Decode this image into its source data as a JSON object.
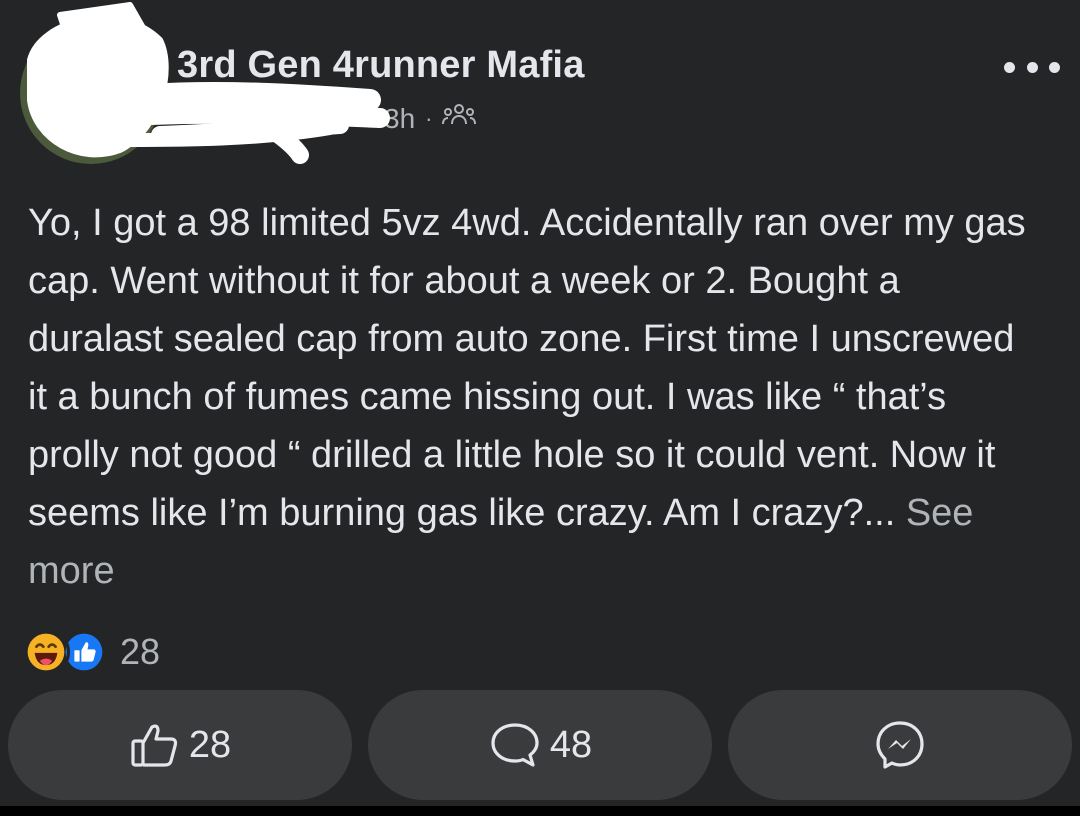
{
  "post": {
    "group_name": "3rd Gen 4runner Mafia",
    "time": "3h",
    "separator": "·",
    "audience_icon": "group-members-icon",
    "more_icon": "more-horizontal-icon",
    "body": "Yo, I got a 98 limited 5vz 4wd. Accidentally ran over my gas cap. Went without it for about a week or 2. Bought a duralast sealed cap from auto zone. First time I unscrewed it a bunch of fumes came hissing out. I was like “ that’s prolly not good “ drilled a little hole so it could vent. Now it seems like I’m burning gas like crazy. Am I crazy?...",
    "see_more": "See more"
  },
  "reactions": {
    "icons": [
      "haha-reaction-icon",
      "like-reaction-icon"
    ],
    "count": "28"
  },
  "actions": {
    "like": {
      "icon": "thumbs-up-icon",
      "count": "28"
    },
    "comment": {
      "icon": "comment-bubble-icon",
      "count": "48"
    },
    "share": {
      "icon": "messenger-icon"
    }
  },
  "colors": {
    "background": "#242526",
    "button": "#3a3b3c",
    "text": "#e4e6eb",
    "muted": "#b0b3b8",
    "like_blue": "#1877f2",
    "haha_yellow": "#f7b125"
  }
}
